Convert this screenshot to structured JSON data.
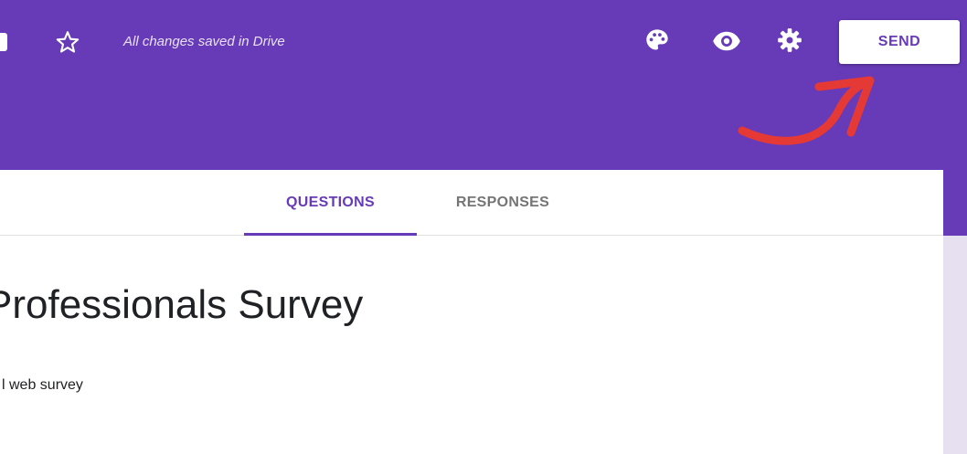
{
  "header": {
    "status_text": "All changes saved in Drive",
    "send_label": "SEND",
    "icons": [
      "folder-icon",
      "star-icon",
      "palette-icon",
      "eye-icon",
      "gear-icon"
    ],
    "colors": {
      "brand": "#673ab7",
      "annotation": "#e53935"
    }
  },
  "tabs": [
    {
      "label": "QUESTIONS",
      "active": true
    },
    {
      "label": "RESPONSES",
      "active": false
    }
  ],
  "form": {
    "title": "Professionals Survey",
    "description": "l web survey"
  }
}
